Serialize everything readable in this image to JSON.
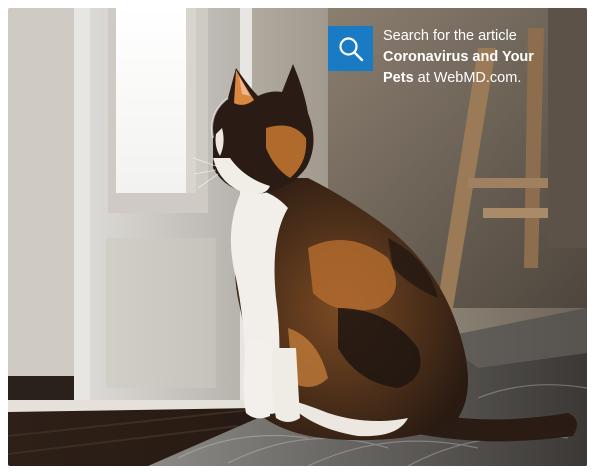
{
  "promo": {
    "line1": "Search for the article",
    "article_title_part1": "Coronavirus and Your",
    "article_title_part2": "Pets",
    "line3_suffix": " at WebMD.com.",
    "search_icon": "search-icon",
    "accent_color": "#1a7bc4"
  },
  "photo": {
    "subject": "cat-image"
  }
}
